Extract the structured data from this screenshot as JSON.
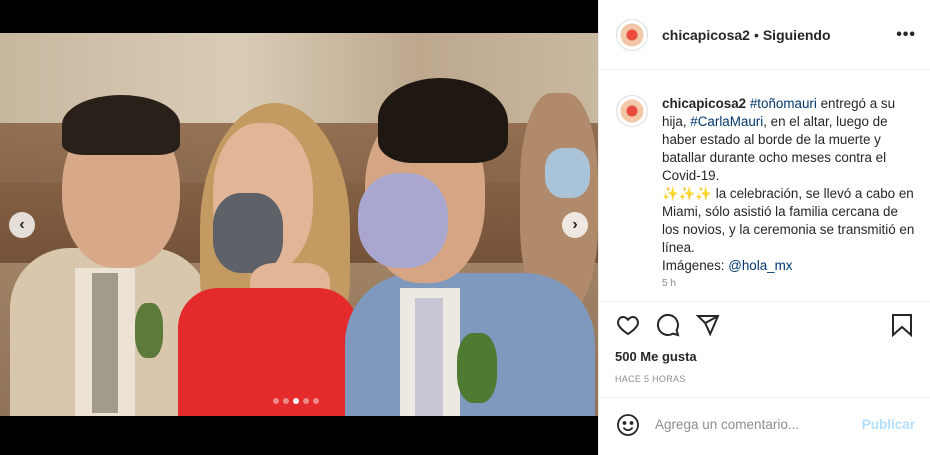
{
  "post": {
    "username": "chicapicosa2",
    "separator": "•",
    "follow_status": "Siguiendo",
    "more_label": "•••"
  },
  "caption": {
    "username": "chicapicosa2",
    "segments": [
      {
        "text": "#toñomauri",
        "link": true
      },
      {
        "text": " entregó a su hija, ",
        "link": false
      },
      {
        "text": "#CarlaMauri",
        "link": true
      },
      {
        "text": ", en el altar, luego de haber estado al borde de la muerte y batallar durante ocho meses contra el Covid-19.",
        "link": false
      }
    ],
    "line2": "✨✨✨ la celebración, se llevó a cabo en Miami, sólo asistió la familia cercana de los novios, y la ceremonia se transmitió en línea.",
    "credits_prefix": "Imágenes: ",
    "credits_link": "@hola_mx",
    "truncated": "5 h"
  },
  "engagement": {
    "likes": "500 Me gusta",
    "time": "HACE 5 HORAS"
  },
  "comment": {
    "placeholder": "Agrega un comentario...",
    "post_label": "Publicar"
  },
  "carousel": {
    "prev": "‹",
    "next": "›",
    "dots": 5,
    "active_dot": 2
  },
  "colors": {
    "link": "#00376b",
    "post_disabled": "#b2dffc"
  }
}
